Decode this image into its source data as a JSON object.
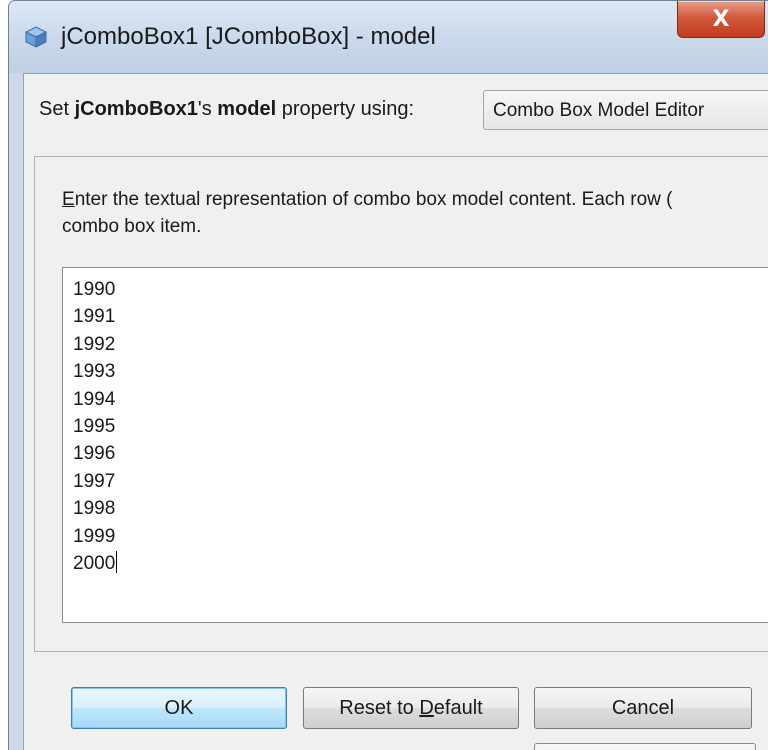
{
  "window": {
    "title": "jComboBox1 [JComboBox] - model",
    "close_glyph": "X"
  },
  "property_row": {
    "prefix": "Set ",
    "component": "jComboBox1",
    "possessive": "'s ",
    "property": "model",
    "suffix": " property using:",
    "editor_selected": "Combo Box Model Editor"
  },
  "editor": {
    "hint_mnemonic": "E",
    "hint_line1_rest": "nter the textual representation of combo box model content. Each row (",
    "hint_line2": "combo box item.",
    "items": [
      "1990",
      "1991",
      "1992",
      "1993",
      "1994",
      "1995",
      "1996",
      "1997",
      "1998",
      "1999",
      "2000"
    ]
  },
  "buttons": {
    "ok": "OK",
    "reset_prefix": "Reset to ",
    "reset_mnemonic": "D",
    "reset_suffix": "efault",
    "cancel": "Cancel"
  },
  "icons": {
    "app_icon": "cube-icon",
    "close_icon": "close-icon"
  },
  "colors": {
    "close_button": "#c43b1d",
    "default_button_border": "#3c7fb1",
    "titlebar": "#c9d8ea"
  }
}
